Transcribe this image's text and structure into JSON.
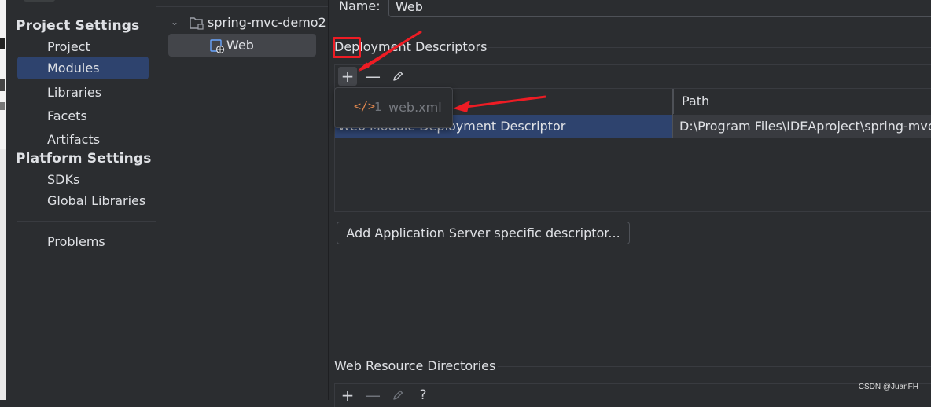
{
  "sidebar": {
    "project_settings_title": "Project Settings",
    "project_items": [
      "Project",
      "Modules",
      "Libraries",
      "Facets",
      "Artifacts"
    ],
    "platform_settings_title": "Platform Settings",
    "platform_items": [
      "SDKs",
      "Global Libraries"
    ],
    "problems": "Problems",
    "selected": "Modules"
  },
  "module_tree": {
    "project_name": "spring-mvc-demo2",
    "facet_name": "Web",
    "project_icon": "folder-module-icon",
    "facet_icon": "web-facet-icon"
  },
  "main": {
    "name_label": "Name:",
    "name_value": "Web",
    "deployment_descriptors_title": "Deployment Descriptors",
    "table_header_path": "Path",
    "row_type": "Web Module Deployment Descriptor",
    "row_path": "D:\\Program Files\\IDEAproject\\spring-mvc-",
    "add_server_descriptor_label": "Add Application Server specific descriptor...",
    "web_resource_dirs_title": "Web Resource Directories",
    "help_label": "?"
  },
  "popup": {
    "icon": "xml-tag-icon",
    "icon_glyph": "</>",
    "item_number": "1",
    "item_label": "web.xml"
  },
  "toolbar_icons": [
    "add-icon",
    "remove-icon",
    "edit-icon"
  ],
  "annotation_color": "#ee1c24",
  "watermark": "CSDN @JuanFH"
}
